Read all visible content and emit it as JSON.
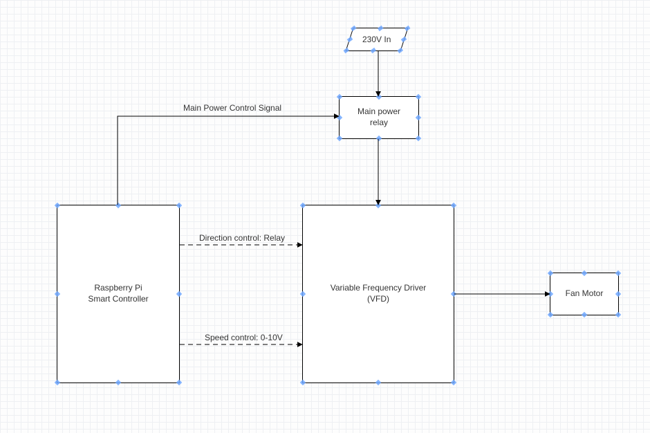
{
  "diagram": {
    "nodes": {
      "input230v": "230V In",
      "mainPowerRelay": "Main power\nrelay",
      "raspberryPi": "Raspberry Pi\nSmart Controller",
      "vfd": "Variable Frequency Driver\n(VFD)",
      "fanMotor": "Fan Motor"
    },
    "edges": {
      "mainPowerControl": "Main Power Control Signal",
      "directionControl": "Direction control: Relay",
      "speedControl": "Speed control: 0-10V"
    }
  }
}
